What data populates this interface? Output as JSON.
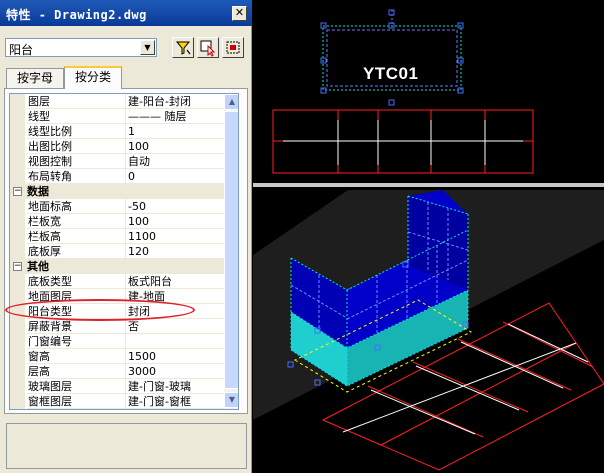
{
  "window": {
    "title": "特性 - Drawing2.dwg",
    "close_symbol": "✕"
  },
  "toolbar": {
    "object_type": "阳台"
  },
  "tabs": [
    {
      "label": "按字母"
    },
    {
      "label": "按分类"
    }
  ],
  "properties": {
    "general": [
      {
        "name": "图层",
        "value": "建-阳台-封闭"
      },
      {
        "name": "线型",
        "value": "——— 随层"
      },
      {
        "name": "线型比例",
        "value": "1"
      },
      {
        "name": "出图比例",
        "value": "100"
      },
      {
        "name": "视图控制",
        "value": "自动"
      },
      {
        "name": "布局转角",
        "value": "0"
      }
    ],
    "data_category": "数据",
    "data": [
      {
        "name": "地面标高",
        "value": "-50"
      },
      {
        "name": "栏板宽",
        "value": "100"
      },
      {
        "name": "栏板高",
        "value": "1100"
      },
      {
        "name": "底板厚",
        "value": "120"
      }
    ],
    "other_category": "其他",
    "other": [
      {
        "name": "底板类型",
        "value": "板式阳台"
      },
      {
        "name": "地面图层",
        "value": "建-地面"
      },
      {
        "name": "阳台类型",
        "value": "封闭"
      },
      {
        "name": "屏蔽背景",
        "value": "否"
      },
      {
        "name": "门窗编号",
        "value": ""
      },
      {
        "name": "窗高",
        "value": "1500"
      },
      {
        "name": "层高",
        "value": "3000"
      },
      {
        "name": "玻璃图层",
        "value": "建-门窗-玻璃"
      },
      {
        "name": "窗框图层",
        "value": "建-门窗-窗框"
      }
    ]
  },
  "drawing": {
    "label": "YTC01"
  },
  "colors": {
    "titlebar": "#0a3a98",
    "highlight": "#e0202a",
    "cad_red": "#ff2020",
    "cad_cyan": "#00e5e5",
    "cad_blue": "#0000c8"
  },
  "icons": [
    "quick-select-icon",
    "pick-add-icon",
    "select-objects-icon",
    "collapse-icon",
    "scroll-up-icon",
    "scroll-down-icon",
    "dropdown-arrow-icon"
  ]
}
